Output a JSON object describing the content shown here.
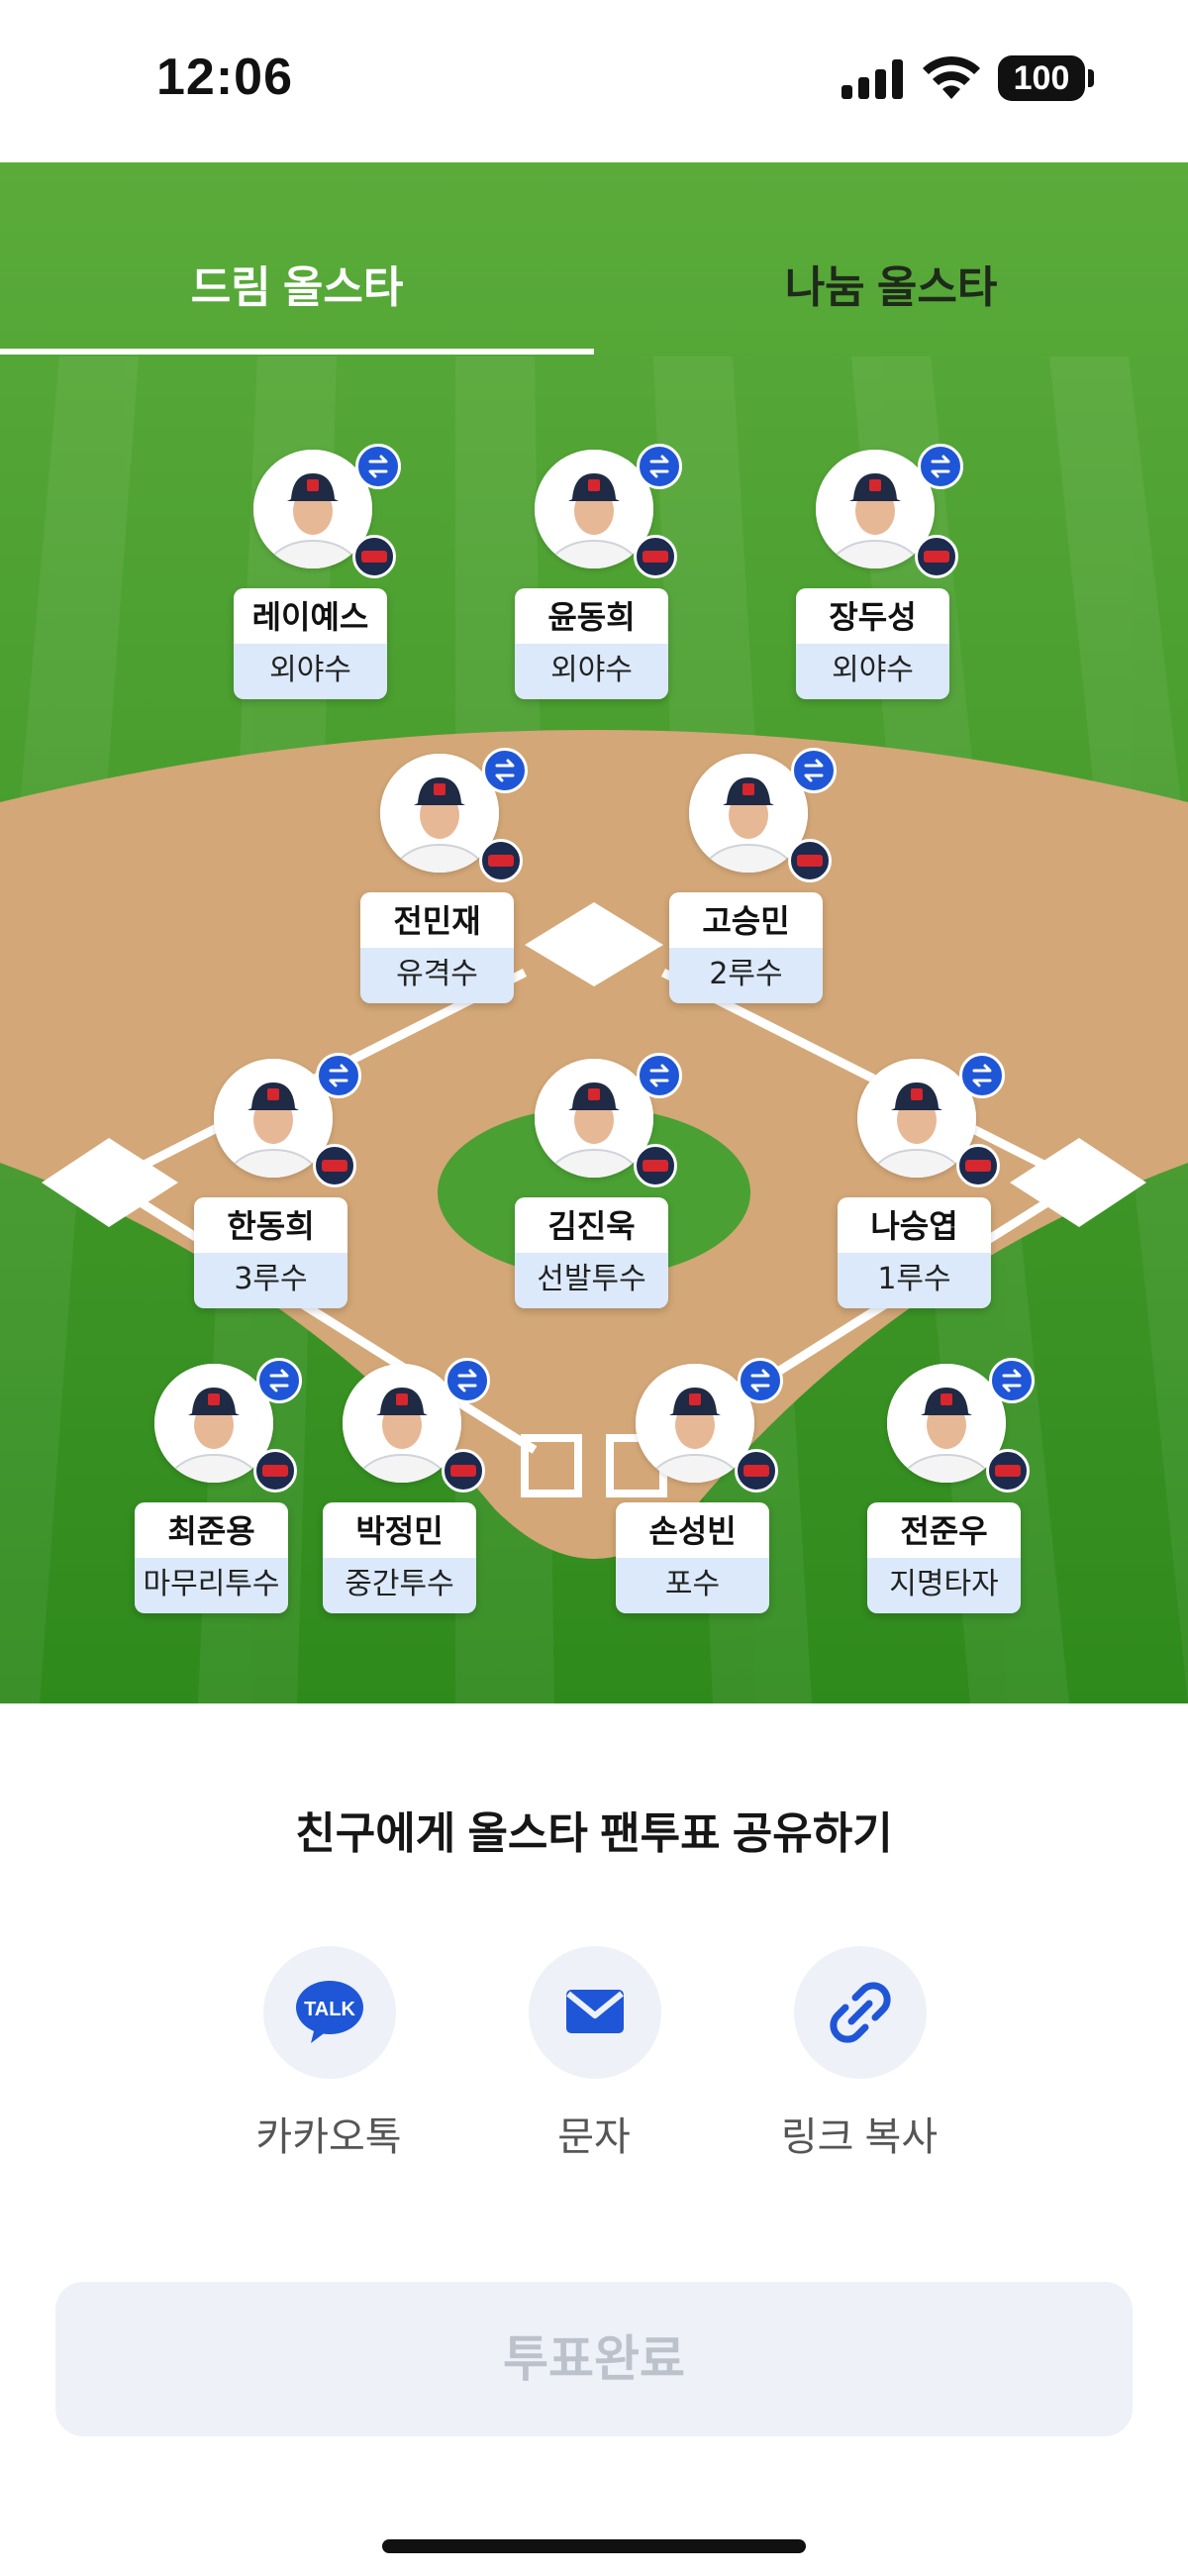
{
  "status_bar": {
    "time": "12:06",
    "battery": "100"
  },
  "tabs": [
    {
      "label": "드림 올스타",
      "active": true
    },
    {
      "label": "나눔 올스타",
      "active": false
    }
  ],
  "players": [
    {
      "name": "레이예스",
      "position": "외야수"
    },
    {
      "name": "윤동희",
      "position": "외야수"
    },
    {
      "name": "장두성",
      "position": "외야수"
    },
    {
      "name": "전민재",
      "position": "유격수"
    },
    {
      "name": "고승민",
      "position": "2루수"
    },
    {
      "name": "한동희",
      "position": "3루수"
    },
    {
      "name": "김진욱",
      "position": "선발투수"
    },
    {
      "name": "나승엽",
      "position": "1루수"
    },
    {
      "name": "최준용",
      "position": "마무리투수"
    },
    {
      "name": "박정민",
      "position": "중간투수"
    },
    {
      "name": "손성빈",
      "position": "포수"
    },
    {
      "name": "전준우",
      "position": "지명타자"
    }
  ],
  "icons": {
    "swap": "swap-icon",
    "team": "team-logo-icon",
    "kakao": "kakao-talk-icon",
    "sms": "mail-icon",
    "link": "link-icon"
  },
  "share": {
    "title": "친구에게 올스타 팬투표 공유하기",
    "kakao_label": "카카오톡",
    "sms_label": "문자",
    "link_label": "링크 복사",
    "kakao_icon_text": "TALK"
  },
  "vote_button": {
    "label": "투표완료"
  },
  "colors": {
    "grass": "#3f9a2a",
    "dirt": "#d3a777",
    "swap_badge": "#1f56d8",
    "accent": "#1f56d8",
    "position_bg": "#dbe9fb"
  }
}
